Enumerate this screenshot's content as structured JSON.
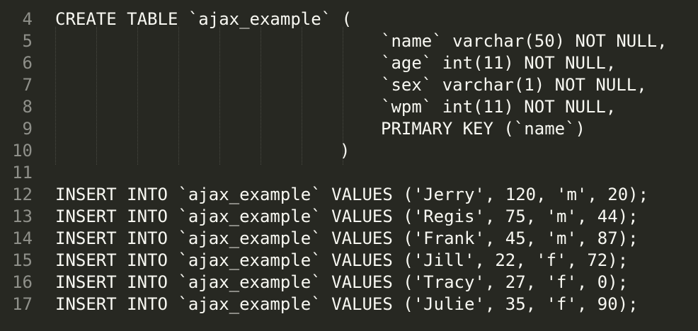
{
  "editor": {
    "lines": [
      {
        "number": "4",
        "text": "CREATE TABLE `ajax_example` (",
        "indent": 0
      },
      {
        "number": "5",
        "text": "`name` varchar(50) NOT NULL,",
        "indent": 460
      },
      {
        "number": "6",
        "text": "`age` int(11) NOT NULL,",
        "indent": 460
      },
      {
        "number": "7",
        "text": "`sex` varchar(1) NOT NULL,",
        "indent": 460
      },
      {
        "number": "8",
        "text": "`wpm` int(11) NOT NULL,",
        "indent": 460
      },
      {
        "number": "9",
        "text": "PRIMARY KEY (`name`)",
        "indent": 460
      },
      {
        "number": "10",
        "text": ")",
        "indent": 402
      },
      {
        "number": "11",
        "text": "",
        "indent": 0
      },
      {
        "number": "12",
        "text": "INSERT INTO `ajax_example` VALUES ('Jerry', 120, 'm', 20);",
        "indent": 0
      },
      {
        "number": "13",
        "text": "INSERT INTO `ajax_example` VALUES ('Regis', 75, 'm', 44);",
        "indent": 0
      },
      {
        "number": "14",
        "text": "INSERT INTO `ajax_example` VALUES ('Frank', 45, 'm', 87);",
        "indent": 0
      },
      {
        "number": "15",
        "text": "INSERT INTO `ajax_example` VALUES ('Jill', 22, 'f', 72);",
        "indent": 0
      },
      {
        "number": "16",
        "text": "INSERT INTO `ajax_example` VALUES ('Tracy', 27, 'f', 0);",
        "indent": 0
      },
      {
        "number": "17",
        "text": "INSERT INTO `ajax_example` VALUES ('Julie', 35, 'f', 90);",
        "indent": 0
      }
    ]
  },
  "colors": {
    "background": "#272822",
    "text": "#f8f8f2",
    "gutter_text": "#8f908a",
    "indent_guide": "#4a4b44"
  }
}
